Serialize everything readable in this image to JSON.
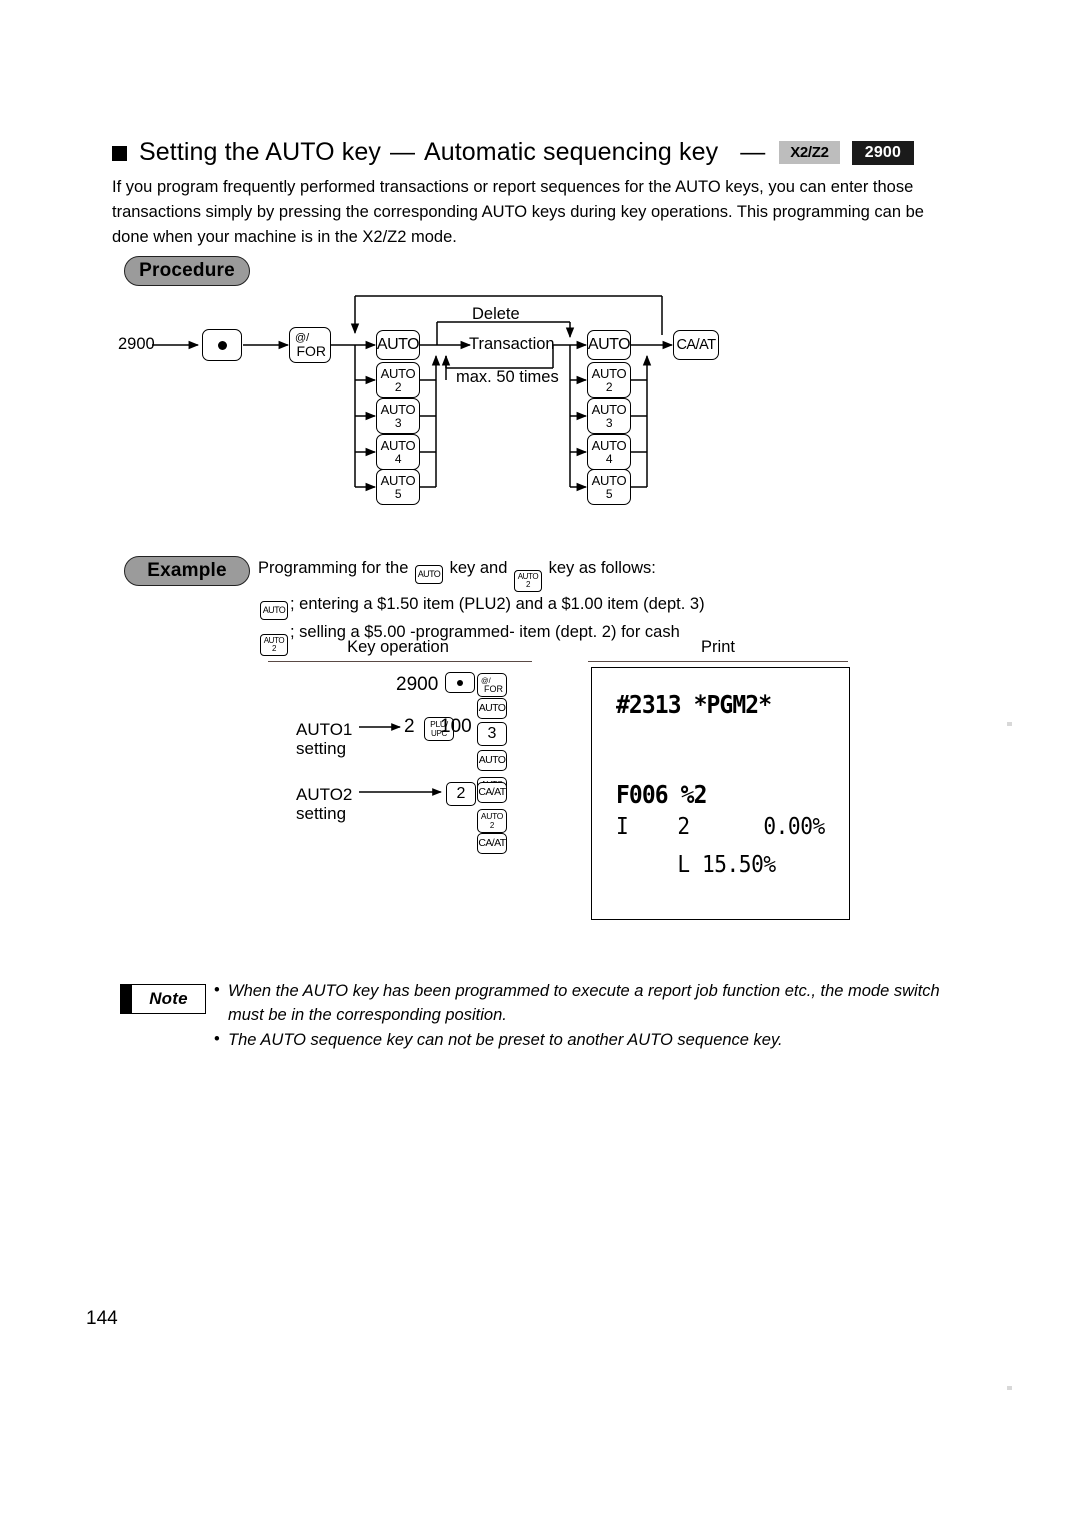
{
  "heading": {
    "bullet_icon": "black-square-bullet",
    "title": "Setting the AUTO key",
    "dash1": "—",
    "subtitle": "Automatic sequencing key",
    "dash2": "—",
    "mode_badge": "X2/Z2",
    "code_badge": "2900"
  },
  "intro": "If you program frequently performed transactions or report sequences for the AUTO keys, you can enter those transactions simply by pressing the corresponding AUTO keys during key operations. This programming can be done when your machine is in the X2/Z2 mode.",
  "procedure": {
    "pill_label": "Procedure",
    "start_value": "2900",
    "keys": {
      "dot": "•",
      "for_top": "@/",
      "for_bottom": "FOR",
      "auto": "AUTO",
      "auto2_top": "AUTO",
      "auto2_bottom": "2",
      "auto3_top": "AUTO",
      "auto3_bottom": "3",
      "auto4_top": "AUTO",
      "auto4_bottom": "4",
      "auto5_top": "AUTO",
      "auto5_bottom": "5",
      "caat": "CA/AT"
    },
    "delete_label": "Delete",
    "transaction_label": "Transaction",
    "max_label": "max. 50 times"
  },
  "example": {
    "pill_label": "Example",
    "line1_pre": "Programming for the",
    "line1_mid": "key and",
    "line1_post": "key as follows:",
    "line2": "; entering a $1.50 item (PLU2) and a $1.00 item (dept. 3)",
    "line3": "; selling a $5.00 -programmed- item (dept. 2) for cash",
    "col_key_operation": "Key operation",
    "col_print": "Print",
    "key_ops": {
      "value_2900": "2900",
      "auto1_label_l1": "AUTO1",
      "auto1_label_l2": "setting",
      "auto2_label_l1": "AUTO2",
      "auto2_label_l2": "setting",
      "num_2": "2",
      "num_100": "100",
      "num_2b": "2",
      "plu_top": "PLU/",
      "plu_bottom": "UPC",
      "dot": "•",
      "for_top": "@/",
      "for_bottom": "FOR",
      "auto": "AUTO",
      "auto2_top": "AUTO",
      "auto2_bottom": "2",
      "key_3": "3",
      "caat": "CA/AT"
    },
    "receipt": {
      "line1": "#2313 *PGM2*",
      "line2": "F006 %2",
      "line3": "I    2      0.00%",
      "line4": "     L 15.50%"
    }
  },
  "note": {
    "badge_label": "Note",
    "bullet": "•",
    "items": [
      "When the AUTO key has been programmed to execute a report job function etc., the mode switch must be in the corresponding position.",
      "The AUTO sequence key can not be preset to another AUTO sequence key."
    ]
  },
  "page_number": "144",
  "colors": {
    "pill_fill": "#9b9b9b",
    "mode_badge_fill": "#bdbdbd",
    "code_badge_fill": "#1b1b1b",
    "rule": "#5a4a45"
  }
}
